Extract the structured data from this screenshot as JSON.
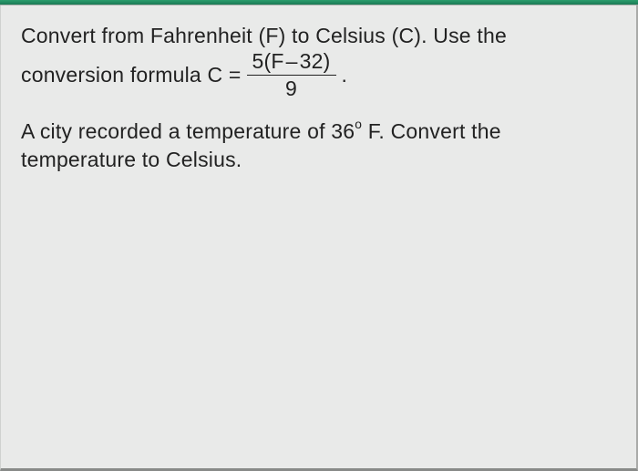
{
  "problem": {
    "line1": "Convert from Fahrenheit (F) to Celsius (C). Use the",
    "formula_prefix": "conversion formula C =",
    "formula_numerator_left": "5(F",
    "formula_numerator_dash": "–",
    "formula_numerator_right": "32)",
    "formula_denominator": "9",
    "formula_suffix": ".",
    "line3_a": "A city recorded a temperature of 36",
    "line3_deg": "o",
    "line3_b": " F. Convert the",
    "line4": "temperature to Celsius."
  }
}
